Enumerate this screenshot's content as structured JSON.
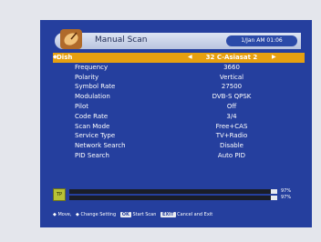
{
  "header": {
    "title": "Manual Scan",
    "time": "1/Jan AM 01:06"
  },
  "settings": [
    {
      "label": "Dish",
      "value": "32 C-Asiasat 2"
    },
    {
      "label": "Frequency",
      "value": "3660"
    },
    {
      "label": "Polarity",
      "value": "Vertical"
    },
    {
      "label": "Symbol Rate",
      "value": "27500"
    },
    {
      "label": "Modulation",
      "value": "DVB-S QPSK"
    },
    {
      "label": "Pilot",
      "value": "Off"
    },
    {
      "label": "Code Rate",
      "value": "3/4"
    },
    {
      "label": "Scan Mode",
      "value": "Free+CAS"
    },
    {
      "label": "Service Type",
      "value": "TV+Radio"
    },
    {
      "label": "Network Search",
      "value": "Disable"
    },
    {
      "label": "PID Search",
      "value": "Auto PID"
    }
  ],
  "signal": {
    "icon_label": "TP",
    "strength": "97%",
    "quality": "97%",
    "strength_fraction": 0.97,
    "quality_fraction": 0.97
  },
  "footer": {
    "move": "Move,",
    "change": "Change Setting",
    "ok_key": "OK",
    "ok_text": "Start Scan",
    "exit_key": "EXIT",
    "exit_text": "Cancel and Exit"
  },
  "icons": [
    "dish-icon",
    "updown-icon",
    "leftright-icon",
    "signal-icon"
  ],
  "colors": {
    "background": "#253f9e",
    "selected": "#e6a010",
    "header": "#c7d0e7"
  }
}
